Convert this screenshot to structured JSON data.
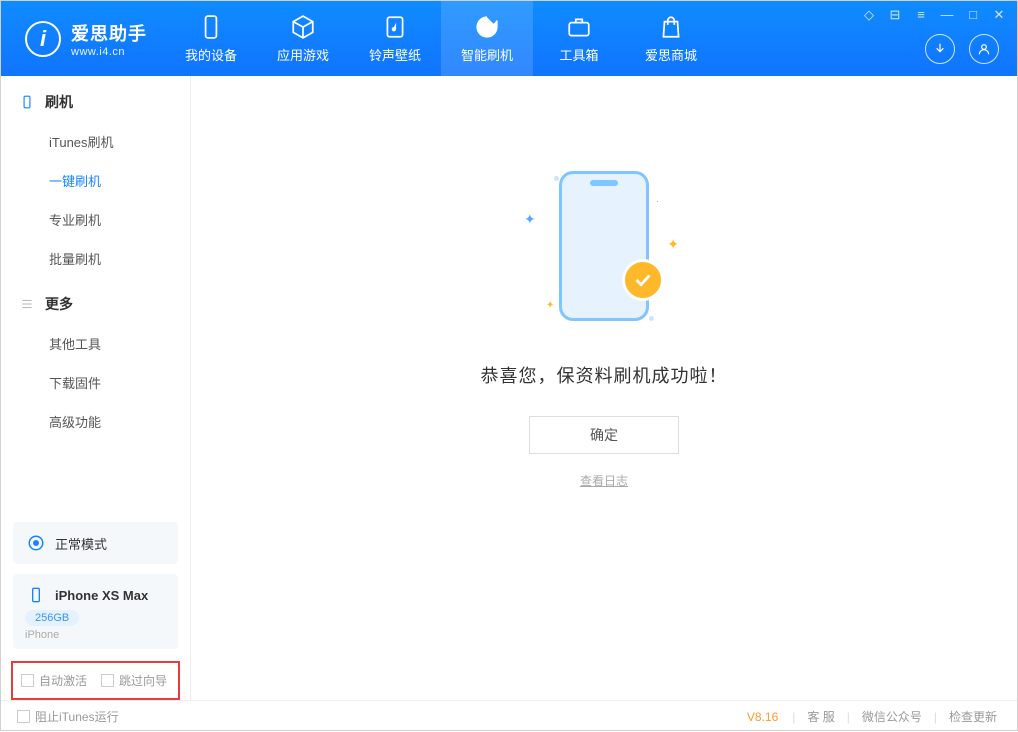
{
  "header": {
    "logo_letter": "i",
    "app_name": "爱思助手",
    "app_url": "www.i4.cn",
    "tabs": [
      {
        "label": "我的设备"
      },
      {
        "label": "应用游戏"
      },
      {
        "label": "铃声壁纸"
      },
      {
        "label": "智能刷机"
      },
      {
        "label": "工具箱"
      },
      {
        "label": "爱思商城"
      }
    ]
  },
  "sidebar": {
    "group1_title": "刷机",
    "group1_items": [
      "iTunes刷机",
      "一键刷机",
      "专业刷机",
      "批量刷机"
    ],
    "group2_title": "更多",
    "group2_items": [
      "其他工具",
      "下载固件",
      "高级功能"
    ],
    "mode_label": "正常模式",
    "device_name": "iPhone XS Max",
    "device_storage": "256GB",
    "device_type": "iPhone",
    "opt_auto_activate": "自动激活",
    "opt_skip_guide": "跳过向导"
  },
  "main": {
    "success_msg": "恭喜您，保资料刷机成功啦！",
    "ok_button": "确定",
    "view_log": "查看日志"
  },
  "footer": {
    "block_itunes": "阻止iTunes运行",
    "version": "V8.16",
    "link_service": "客 服",
    "link_wechat": "微信公众号",
    "link_update": "检查更新"
  }
}
